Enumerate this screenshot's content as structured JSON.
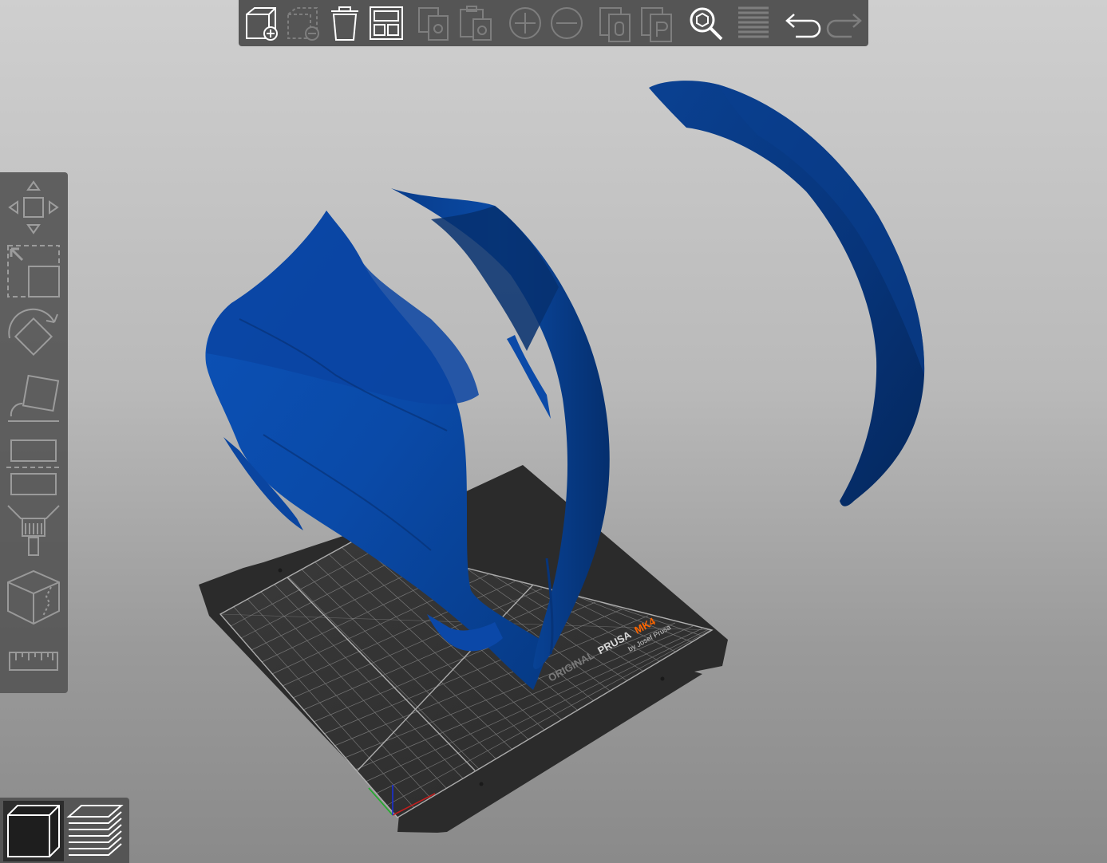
{
  "app": {
    "accent_color": "#ff6600",
    "model_color": "#0b4aa5",
    "toolbar_bg": "#555555"
  },
  "top_toolbar": {
    "items": [
      {
        "icon": "add-object-icon",
        "enabled": true
      },
      {
        "icon": "delete-object-icon",
        "enabled": false
      },
      {
        "icon": "delete-all-icon",
        "enabled": true
      },
      {
        "icon": "arrange-icon",
        "enabled": true
      },
      {
        "icon": "copy-icon",
        "enabled": false
      },
      {
        "icon": "paste-icon",
        "enabled": false
      },
      {
        "icon": "add-instance-icon",
        "enabled": false
      },
      {
        "icon": "remove-instance-icon",
        "enabled": false
      },
      {
        "icon": "split-objects-icon",
        "enabled": false
      },
      {
        "icon": "split-parts-icon",
        "enabled": false
      },
      {
        "icon": "search-icon",
        "enabled": true
      },
      {
        "icon": "layer-editing-icon",
        "enabled": false
      },
      {
        "icon": "undo-icon",
        "enabled": true
      },
      {
        "icon": "redo-icon",
        "enabled": false
      }
    ]
  },
  "left_toolbar": {
    "items": [
      {
        "icon": "move-icon"
      },
      {
        "icon": "scale-icon"
      },
      {
        "icon": "rotate-icon"
      },
      {
        "icon": "place-on-face-icon"
      },
      {
        "icon": "cut-icon"
      },
      {
        "icon": "paint-supports-icon"
      },
      {
        "icon": "seam-painting-icon"
      },
      {
        "icon": "measure-icon"
      }
    ]
  },
  "view_toggle": {
    "items": [
      {
        "icon": "3d-view-icon",
        "active": true
      },
      {
        "icon": "preview-layers-icon",
        "active": false
      }
    ]
  },
  "bed": {
    "brand_line1_a": "ORIGINAL",
    "brand_line1_b": "PRUSA",
    "brand_line1_c": "MK4",
    "brand_line2": "by Josef Prusa"
  }
}
